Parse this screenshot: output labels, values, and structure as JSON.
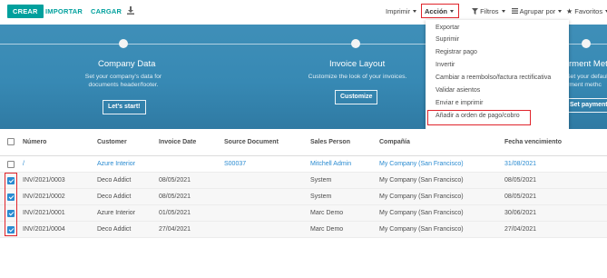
{
  "toolbar": {
    "create_label": "CREAR",
    "import_label": "IMPORTAR",
    "upload_label": "CARGAR",
    "print_label": "Imprimir",
    "action_label": "Acción",
    "filters_label": "Filtros",
    "group_by_label": "Agrupar por",
    "favorites_label": "Favoritos"
  },
  "banner": {
    "steps": [
      {
        "title": "Company Data",
        "desc1": "Set your company's data for",
        "desc2": "documents header/footer.",
        "button": "Let's start!"
      },
      {
        "title": "Invoice Layout",
        "desc1": "Customize the look of your invoices.",
        "desc2": "",
        "button": "Customize"
      },
      {
        "title": "rment Meth",
        "desc1": "Set your default c",
        "desc2": "yment methc",
        "button": "Set payments"
      }
    ]
  },
  "action_menu": {
    "items": [
      "Exportar",
      "Suprimir",
      "Registrar pago",
      "Invertir",
      "Cambiar a reembolso/factura rectificativa",
      "Validar asientos",
      "Enviar e imprimir",
      "Añadir a orden de pago/cobro"
    ]
  },
  "table": {
    "columns": [
      "Número",
      "Customer",
      "Invoice Date",
      "Source Document",
      "Sales Person",
      "Compañía",
      "Fecha vencimiento"
    ],
    "rows": [
      {
        "checked": false,
        "number": "/",
        "customer": "Azure Interior",
        "date": "",
        "source": "S00037",
        "salesperson": "Mitchell Admin",
        "company": "My Company (San Francisco)",
        "due": "31/08/2021"
      },
      {
        "checked": true,
        "number": "INV/2021/0003",
        "customer": "Deco Addict",
        "date": "08/05/2021",
        "source": "",
        "salesperson": "System",
        "company": "My Company (San Francisco)",
        "due": "08/05/2021"
      },
      {
        "checked": true,
        "number": "INV/2021/0002",
        "customer": "Deco Addict",
        "date": "08/05/2021",
        "source": "",
        "salesperson": "System",
        "company": "My Company (San Francisco)",
        "due": "08/05/2021"
      },
      {
        "checked": true,
        "number": "INV/2021/0001",
        "customer": "Azure Interior",
        "date": "01/05/2021",
        "source": "",
        "salesperson": "Marc Demo",
        "company": "My Company (San Francisco)",
        "due": "30/06/2021"
      },
      {
        "checked": true,
        "number": "INV/2021/0004",
        "customer": "Deco Addict",
        "date": "27/04/2021",
        "source": "",
        "salesperson": "Marc Demo",
        "company": "My Company (San Francisco)",
        "due": "27/04/2021"
      }
    ]
  },
  "colors": {
    "primary": "#00a09d",
    "banner": "#3789b4",
    "highlight": "#e0242b",
    "link": "#2a8bd1"
  }
}
